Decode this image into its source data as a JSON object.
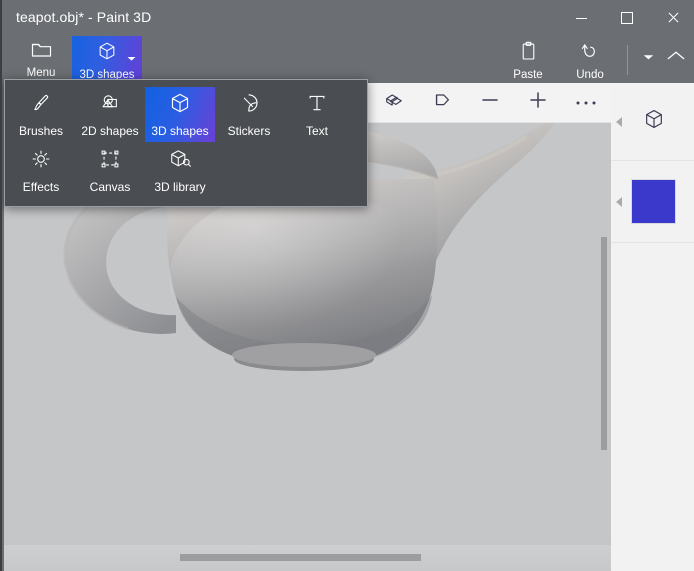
{
  "window": {
    "title": "teapot.obj* - Paint 3D",
    "controls": {
      "minimize": "Minimize",
      "maximize": "Maximize",
      "close": "Close"
    }
  },
  "ribbon": {
    "left_buttons": [
      {
        "id": "menu",
        "label": "Menu",
        "icon": "folder-icon",
        "active": false
      },
      {
        "id": "3d-shapes",
        "label": "3D shapes",
        "icon": "cube-icon",
        "active": true,
        "has_dropdown": true
      }
    ],
    "right_buttons": [
      {
        "id": "paste",
        "label": "Paste",
        "icon": "clipboard-icon"
      },
      {
        "id": "undo",
        "label": "Undo",
        "icon": "undo-arrow-icon"
      }
    ],
    "overflow_icon": "chevron-down-icon",
    "collapse_icon": "chevron-up-icon"
  },
  "flyout": {
    "visible": true,
    "row1": [
      {
        "id": "brushes",
        "label": "Brushes",
        "icon": "paintbrush-icon",
        "selected": false
      },
      {
        "id": "2d-shapes",
        "label": "2D shapes",
        "icon": "shapes-2d-icon",
        "selected": false
      },
      {
        "id": "3d-shapes",
        "label": "3D shapes",
        "icon": "cube-icon",
        "selected": true
      },
      {
        "id": "stickers",
        "label": "Stickers",
        "icon": "sticker-icon",
        "selected": false
      },
      {
        "id": "text",
        "label": "Text",
        "icon": "text-t-icon",
        "selected": false
      }
    ],
    "row2": [
      {
        "id": "effects",
        "label": "Effects",
        "icon": "brightness-sun-icon",
        "selected": false
      },
      {
        "id": "canvas",
        "label": "Canvas",
        "icon": "canvas-frame-icon",
        "selected": false
      },
      {
        "id": "3d-library",
        "label": "3D library",
        "icon": "cube-search-icon",
        "selected": false
      }
    ]
  },
  "canvas_toolbar": {
    "buttons": [
      {
        "id": "view-3d",
        "icon": "3d-view-icon",
        "label": "3D view"
      },
      {
        "id": "camera-view",
        "icon": "camera-view-icon",
        "label": "View"
      },
      {
        "id": "zoom-out",
        "icon": "minus-icon",
        "label": "Zoom out"
      },
      {
        "id": "zoom-in",
        "icon": "plus-icon",
        "label": "Zoom in"
      },
      {
        "id": "more-options",
        "icon": "ellipsis-icon",
        "label": "More options"
      }
    ]
  },
  "canvas": {
    "model_name": "teapot",
    "background_color": "#c4c6c7",
    "model_color": "#a9aaab",
    "vertical_scrollbar": {
      "visible": true
    },
    "horizontal_scrollbar": {
      "visible": true
    }
  },
  "right_panel": {
    "sections": [
      {
        "id": "shape-tools",
        "icon": "cube-icon",
        "collapse_icon": "collapse-left-arrow"
      },
      {
        "id": "color-swatch",
        "swatch_color": "#3b38cc",
        "collapse_icon": "collapse-left-arrow"
      }
    ]
  },
  "colors": {
    "chrome": "#6b6e72",
    "flyout_bg": "#4a4d51",
    "accent_blue": "#1662e0",
    "accent_purple": "#6340d8",
    "panel_bg": "#f2f2f3",
    "swatch_blue": "#3b38cc"
  }
}
